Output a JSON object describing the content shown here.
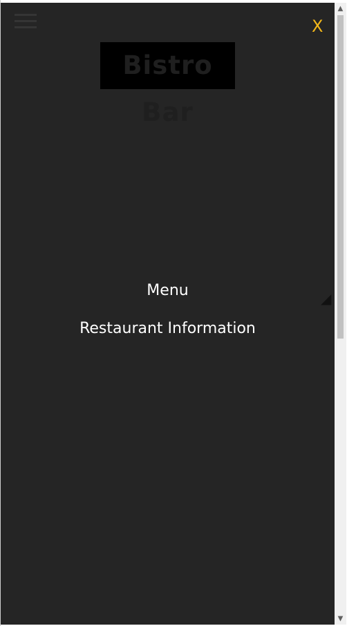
{
  "header": {
    "logo_text": "Bistro Bar",
    "close_label": "X",
    "menu_icon": "hamburger-menu-icon"
  },
  "nav": {
    "items": [
      {
        "label": "Menu"
      },
      {
        "label": "Restaurant Information"
      }
    ]
  },
  "colors": {
    "overlay_background": "#252525",
    "close_color": "#f3b81a",
    "nav_text": "#ffffff"
  },
  "scrollbar": {
    "up_arrow": "▲",
    "down_arrow": "▼"
  }
}
